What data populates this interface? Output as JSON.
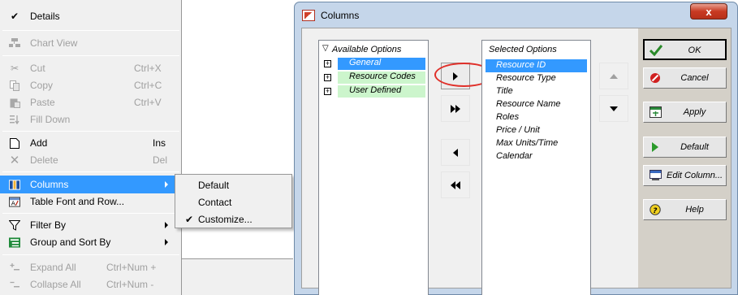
{
  "context_menu": {
    "items": [
      {
        "label": "Details",
        "checked": true,
        "enabled": true
      },
      {
        "label": "Chart View",
        "enabled": false
      },
      {
        "label": "Cut",
        "shortcut": "Ctrl+X",
        "enabled": false
      },
      {
        "label": "Copy",
        "shortcut": "Ctrl+C",
        "enabled": false
      },
      {
        "label": "Paste",
        "shortcut": "Ctrl+V",
        "enabled": false
      },
      {
        "label": "Fill Down",
        "enabled": false
      },
      {
        "label": "Add",
        "shortcut": "Ins",
        "enabled": true
      },
      {
        "label": "Delete",
        "shortcut": "Del",
        "enabled": false
      },
      {
        "label": "Columns",
        "enabled": true,
        "highlighted": true,
        "has_submenu": true
      },
      {
        "label": "Table Font and Row...",
        "enabled": true
      },
      {
        "label": "Filter By",
        "enabled": true,
        "has_submenu": true
      },
      {
        "label": "Group and Sort By",
        "enabled": true,
        "has_submenu": true
      },
      {
        "label": "Expand All",
        "shortcut": "Ctrl+Num +",
        "enabled": false
      },
      {
        "label": "Collapse All",
        "shortcut": "Ctrl+Num -",
        "enabled": false
      }
    ]
  },
  "submenu": {
    "items": [
      {
        "label": "Default",
        "checked": false
      },
      {
        "label": "Contact",
        "checked": false
      },
      {
        "label": "Customize...",
        "checked": true
      }
    ]
  },
  "dialog": {
    "title": "Columns",
    "close_label": "x",
    "available": {
      "header": "Available Options",
      "items": [
        "General",
        "Resource Codes",
        "User Defined"
      ]
    },
    "selected": {
      "header": "Selected Options",
      "items": [
        "Resource ID",
        "Resource Type",
        "Title",
        "Resource Name",
        "Roles",
        "Price / Unit",
        "Max Units/Time",
        "Calendar"
      ]
    },
    "buttons": {
      "ok": "OK",
      "cancel": "Cancel",
      "apply": "Apply",
      "default": "Default",
      "edit_column": "Edit Column...",
      "help": "Help"
    }
  },
  "colors": {
    "menu_highlight": "#3399ff",
    "available_highlight": "#ccf5cc",
    "selected_highlight": "#3399ff",
    "annotation_ring": "#e0302a"
  }
}
